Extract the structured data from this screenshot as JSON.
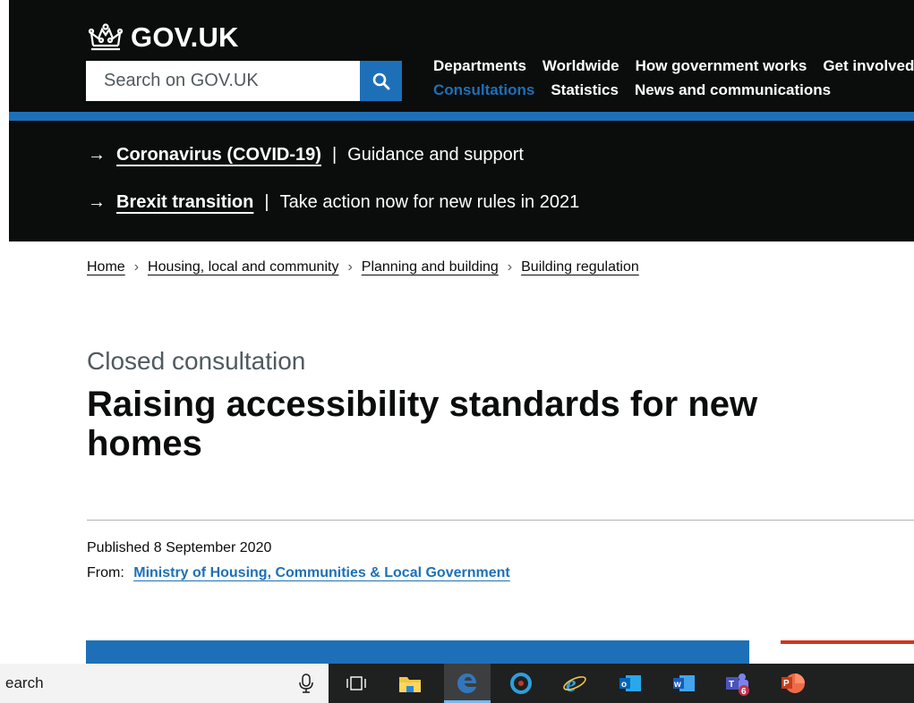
{
  "header": {
    "logo_text": "GOV.UK",
    "search_placeholder": "Search on GOV.UK",
    "nav_row1": [
      "Departments",
      "Worldwide",
      "How government works",
      "Get involved"
    ],
    "nav_row2": [
      "Consultations",
      "Statistics",
      "News and communications"
    ],
    "colors": {
      "background": "#0b0c0c",
      "brand_blue": "#1d70b8"
    }
  },
  "alerts": [
    {
      "link": "Coronavirus (COVID-19)",
      "description": "Guidance and support"
    },
    {
      "link": "Brexit transition",
      "description": "Take action now for new rules in 2021"
    }
  ],
  "breadcrumbs": [
    "Home",
    "Housing, local and community",
    "Planning and building",
    "Building regulation"
  ],
  "page": {
    "caption": "Closed consultation",
    "title": "Raising accessibility standards for new homes",
    "published": "Published 8 September 2020",
    "from_label": "From:",
    "organisation": "Ministry of Housing, Communities & Local Government"
  },
  "taskbar": {
    "search_text": "earch",
    "icons": [
      "microphone-icon",
      "task-view-icon",
      "file-explorer-icon",
      "edge-icon",
      "cortana-icon",
      "internet-explorer-icon",
      "outlook-icon",
      "word-icon",
      "teams-icon",
      "powerpoint-icon"
    ],
    "teams_badge": "6"
  }
}
